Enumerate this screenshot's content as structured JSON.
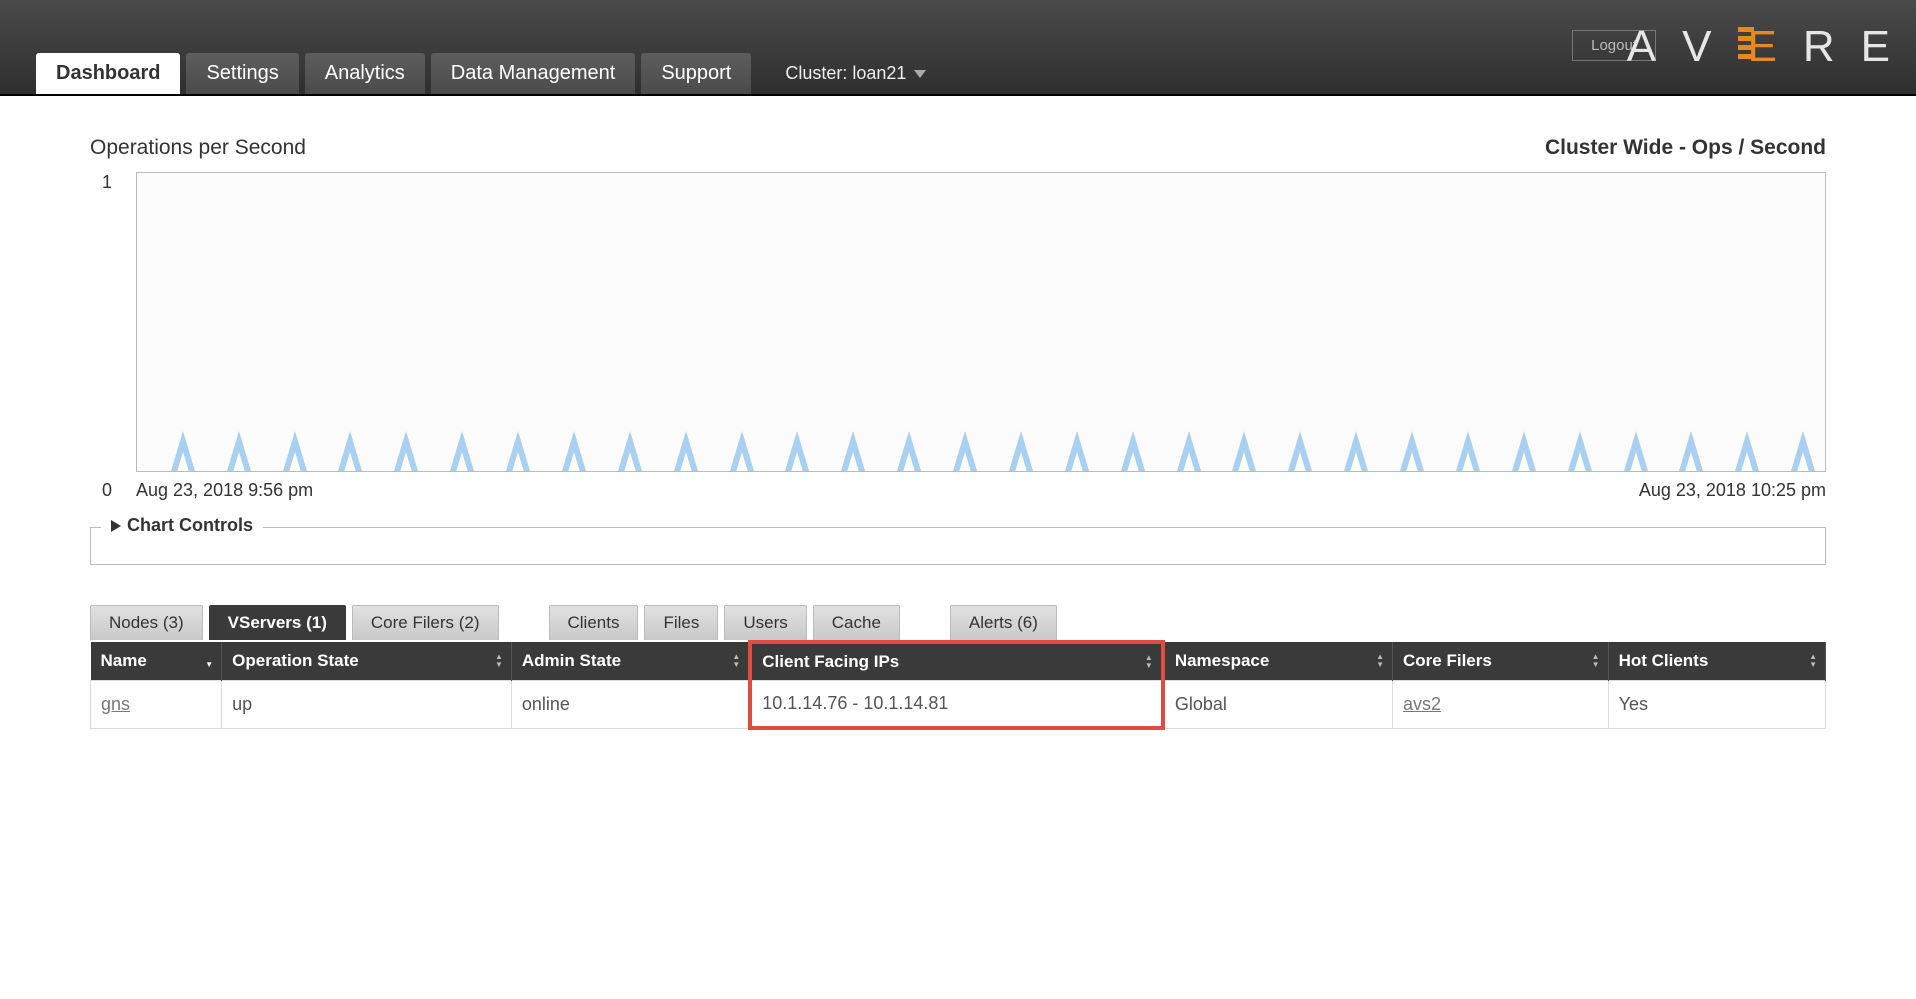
{
  "header": {
    "logout": "Logout",
    "logo_letters": [
      "A",
      "V",
      "E",
      "R",
      "E"
    ],
    "nav": [
      {
        "label": "Dashboard",
        "active": true
      },
      {
        "label": "Settings",
        "active": false
      },
      {
        "label": "Analytics",
        "active": false
      },
      {
        "label": "Data Management",
        "active": false
      },
      {
        "label": "Support",
        "active": false
      }
    ],
    "cluster_label": "Cluster: loan21"
  },
  "chart_header": {
    "left": "Operations per Second",
    "right": "Cluster Wide - Ops / Second"
  },
  "chart_data": {
    "type": "line",
    "title": "Operations per Second",
    "ylabel": "",
    "xlabel": "",
    "ylim": [
      0,
      1
    ],
    "x_start": "Aug 23, 2018 9:56 pm",
    "x_end": "Aug 23, 2018 10:25 pm",
    "y_ticks": [
      0,
      1
    ],
    "series": [
      {
        "name": "Cluster Wide - Ops / Second",
        "peak_value": 0.12,
        "baseline": 0,
        "spike_count": 30
      }
    ]
  },
  "controls_label": "Chart Controls",
  "subtabs": [
    {
      "label": "Nodes (3)",
      "active": false
    },
    {
      "label": "VServers (1)",
      "active": true
    },
    {
      "label": "Core Filers (2)",
      "active": false
    },
    {
      "label": "",
      "gap": true
    },
    {
      "label": "Clients",
      "active": false
    },
    {
      "label": "Files",
      "active": false
    },
    {
      "label": "Users",
      "active": false
    },
    {
      "label": "Cache",
      "active": false
    },
    {
      "label": "",
      "gap": true
    },
    {
      "label": "Alerts (6)",
      "active": false
    }
  ],
  "table": {
    "columns": [
      "Name",
      "Operation State",
      "Admin State",
      "Client Facing IPs",
      "Namespace",
      "Core Filers",
      "Hot Clients"
    ],
    "highlight_column_index": 3,
    "rows": [
      {
        "Name": "gns",
        "Operation State": "up",
        "Admin State": "online",
        "Client Facing IPs": "10.1.14.76 - 10.1.14.81",
        "Namespace": "Global",
        "Core Filers": "avs2",
        "Hot Clients": "Yes"
      }
    ],
    "link_columns": [
      "Name",
      "Core Filers"
    ]
  }
}
